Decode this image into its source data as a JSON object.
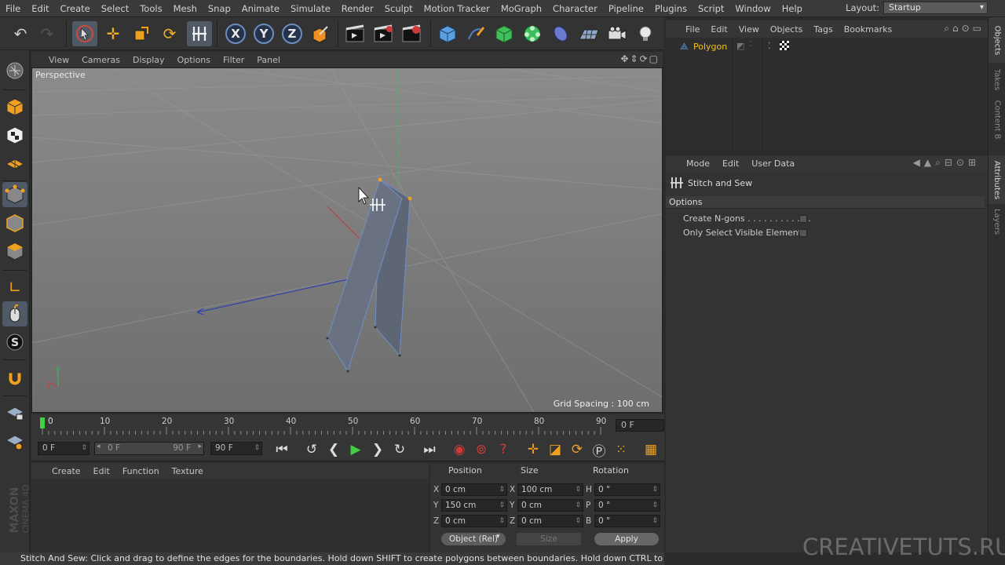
{
  "menubar": {
    "items": [
      "File",
      "Edit",
      "Create",
      "Select",
      "Tools",
      "Mesh",
      "Snap",
      "Animate",
      "Simulate",
      "Render",
      "Sculpt",
      "Motion Tracker",
      "MoGraph",
      "Character",
      "Pipeline",
      "Plugins",
      "Script",
      "Window",
      "Help"
    ],
    "layout_label": "Layout:",
    "layout_value": "Startup"
  },
  "toolbar": {
    "axis_x": "X",
    "axis_y": "Y",
    "axis_z": "Z"
  },
  "viewport": {
    "menu": [
      "View",
      "Cameras",
      "Display",
      "Options",
      "Filter",
      "Panel"
    ],
    "label": "Perspective",
    "grid_spacing": "Grid Spacing : 100 cm"
  },
  "timeline": {
    "ticks": [
      "0",
      "10",
      "20",
      "30",
      "40",
      "50",
      "60",
      "70",
      "80",
      "90"
    ],
    "current_frame": "0 F"
  },
  "transport": {
    "start_frame": "0 F",
    "range_start": "0 F",
    "range_end": "90 F",
    "end_frame": "90 F"
  },
  "material": {
    "menu": [
      "Create",
      "Edit",
      "Function",
      "Texture"
    ]
  },
  "coordinates": {
    "headers": {
      "position": "Position",
      "size": "Size",
      "rotation": "Rotation"
    },
    "rows": [
      {
        "axis": "X",
        "pos": "0 cm",
        "size_axis": "X",
        "size": "100 cm",
        "rot_axis": "H",
        "rot": "0 °"
      },
      {
        "axis": "Y",
        "pos": "150 cm",
        "size_axis": "Y",
        "size": "0 cm",
        "rot_axis": "P",
        "rot": "0 °"
      },
      {
        "axis": "Z",
        "pos": "0 cm",
        "size_axis": "Z",
        "size": "0 cm",
        "rot_axis": "B",
        "rot": "0 °"
      }
    ],
    "mode": "Object (Rel)",
    "size_mode": "Size",
    "apply": "Apply"
  },
  "status": "Stitch And Sew: Click and drag to define the edges for the boundaries. Hold down SHIFT to create polygons between boundaries. Hold down CTRL to stitch to",
  "object_manager": {
    "menu": [
      "File",
      "Edit",
      "View",
      "Objects",
      "Tags",
      "Bookmarks"
    ],
    "object_name": "Polygon"
  },
  "attributes": {
    "menu": [
      "Mode",
      "Edit",
      "User Data"
    ],
    "tool_name": "Stitch and Sew",
    "group": "Options",
    "options": [
      "Create N-gons . . . . . . . . . . . .",
      "Only Select Visible Elements"
    ]
  },
  "right_tabs": [
    "Objects",
    "Takes",
    "Content B",
    "Attributes",
    "Layers"
  ],
  "branding": {
    "maxon": "MAXON",
    "cinema": "CINEMA 4D"
  },
  "watermark": "CREATIVETUTS.RU",
  "colors": {
    "accent_blue": "#4d7fc4",
    "object_name": "#f0c020",
    "play_green": "#3fcf3f",
    "record_red": "#d23a3a"
  }
}
